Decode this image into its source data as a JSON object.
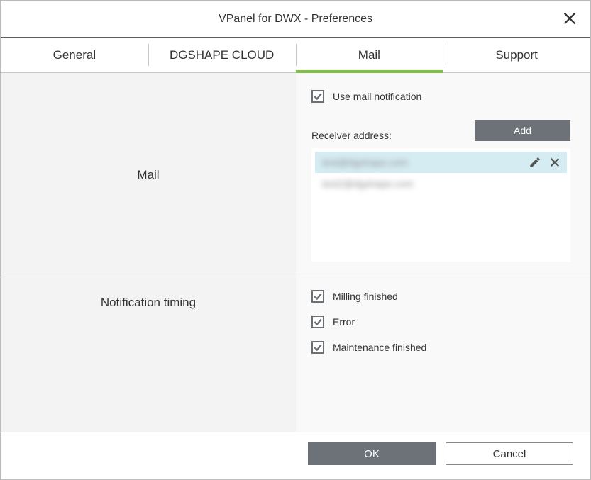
{
  "window": {
    "title": "VPanel for DWX - Preferences"
  },
  "tabs": [
    {
      "label": "General",
      "active": false
    },
    {
      "label": "DGSHAPE CLOUD",
      "active": false
    },
    {
      "label": "Mail",
      "active": true
    },
    {
      "label": "Support",
      "active": false
    }
  ],
  "mail_section": {
    "heading": "Mail",
    "use_mail_notification": {
      "label": "Use mail notification",
      "checked": true
    },
    "receiver_label": "Receiver address:",
    "add_button": "Add",
    "addresses": [
      {
        "text": "test@dgshape.com",
        "selected": true
      },
      {
        "text": "test2@dgshape.com",
        "selected": false
      }
    ]
  },
  "timing_section": {
    "heading": "Notification timing",
    "options": [
      {
        "label": "Milling finished",
        "checked": true
      },
      {
        "label": "Error",
        "checked": true
      },
      {
        "label": "Maintenance finished",
        "checked": true
      }
    ]
  },
  "buttons": {
    "ok": "OK",
    "cancel": "Cancel"
  }
}
